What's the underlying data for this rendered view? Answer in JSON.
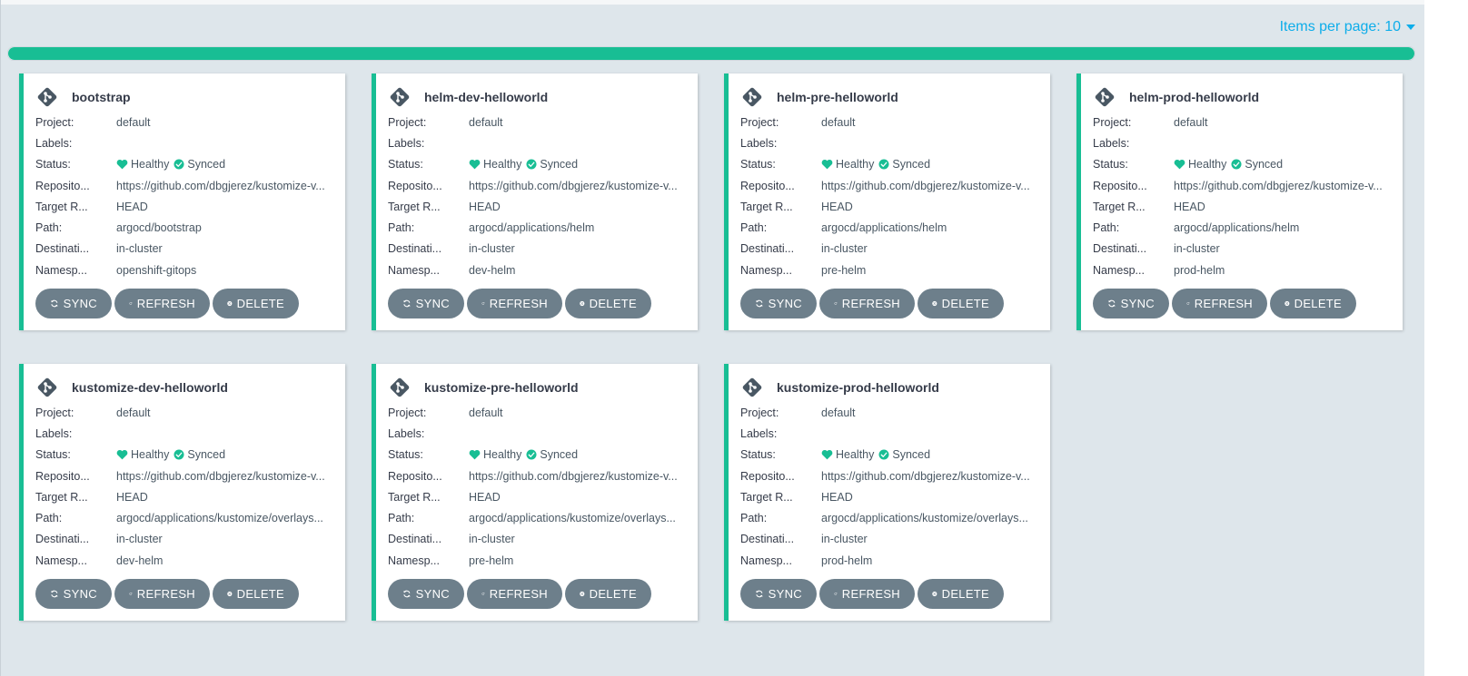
{
  "toolbar": {
    "items_per_page_label": "Items per page: 10"
  },
  "progress": {
    "fraction": 1.0,
    "color": "#18be94"
  },
  "field_labels": {
    "project": "Project:",
    "labels": "Labels:",
    "status": "Status:",
    "repository": "Reposito...",
    "target_revision": "Target R...",
    "path": "Path:",
    "destination": "Destinati...",
    "namespace": "Namesp..."
  },
  "buttons": {
    "sync": "SYNC",
    "refresh": "REFRESH",
    "delete": "DELETE"
  },
  "apps": [
    {
      "name": "bootstrap",
      "project": "default",
      "labels": "",
      "health": "Healthy",
      "sync": "Synced",
      "repo": "https://github.com/dbgjerez/kustomize-v...",
      "target": "HEAD",
      "path": "argocd/bootstrap",
      "destination": "in-cluster",
      "namespace": "openshift-gitops"
    },
    {
      "name": "helm-dev-helloworld",
      "project": "default",
      "labels": "",
      "health": "Healthy",
      "sync": "Synced",
      "repo": "https://github.com/dbgjerez/kustomize-v...",
      "target": "HEAD",
      "path": "argocd/applications/helm",
      "destination": "in-cluster",
      "namespace": "dev-helm"
    },
    {
      "name": "helm-pre-helloworld",
      "project": "default",
      "labels": "",
      "health": "Healthy",
      "sync": "Synced",
      "repo": "https://github.com/dbgjerez/kustomize-v...",
      "target": "HEAD",
      "path": "argocd/applications/helm",
      "destination": "in-cluster",
      "namespace": "pre-helm"
    },
    {
      "name": "helm-prod-helloworld",
      "project": "default",
      "labels": "",
      "health": "Healthy",
      "sync": "Synced",
      "repo": "https://github.com/dbgjerez/kustomize-v...",
      "target": "HEAD",
      "path": "argocd/applications/helm",
      "destination": "in-cluster",
      "namespace": "prod-helm"
    },
    {
      "name": "kustomize-dev-helloworld",
      "project": "default",
      "labels": "",
      "health": "Healthy",
      "sync": "Synced",
      "repo": "https://github.com/dbgjerez/kustomize-v...",
      "target": "HEAD",
      "path": "argocd/applications/kustomize/overlays...",
      "destination": "in-cluster",
      "namespace": "dev-helm"
    },
    {
      "name": "kustomize-pre-helloworld",
      "project": "default",
      "labels": "",
      "health": "Healthy",
      "sync": "Synced",
      "repo": "https://github.com/dbgjerez/kustomize-v...",
      "target": "HEAD",
      "path": "argocd/applications/kustomize/overlays...",
      "destination": "in-cluster",
      "namespace": "pre-helm"
    },
    {
      "name": "kustomize-prod-helloworld",
      "project": "default",
      "labels": "",
      "health": "Healthy",
      "sync": "Synced",
      "repo": "https://github.com/dbgjerez/kustomize-v...",
      "target": "HEAD",
      "path": "argocd/applications/kustomize/overlays...",
      "destination": "in-cluster",
      "namespace": "prod-helm"
    }
  ],
  "colors": {
    "accent": "#18be94",
    "link": "#0dadea",
    "button": "#6d7f8b",
    "background": "#dee6eb"
  },
  "icons": {
    "app": "git-diamond-icon",
    "health": "heart-icon",
    "sync_status": "check-circle-icon",
    "sync_button": "sync-icon",
    "refresh_button": "refresh-icon",
    "delete_button": "times-circle-icon"
  }
}
